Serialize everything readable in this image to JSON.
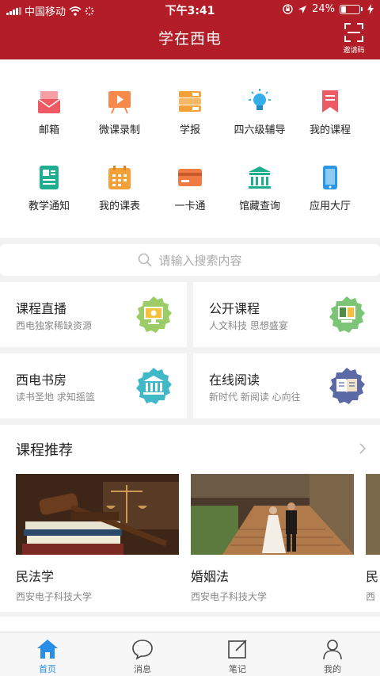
{
  "status_bar": {
    "carrier": "中国移动",
    "time": "下午3:41",
    "battery": "24%"
  },
  "header": {
    "title": "学在西电",
    "invite_label": "邀请码"
  },
  "grid_items": [
    {
      "label": "邮箱",
      "icon": "mail-icon",
      "color": "#ee5a63"
    },
    {
      "label": "微课录制",
      "icon": "video-record-icon",
      "color": "#f58a4c"
    },
    {
      "label": "学报",
      "icon": "journal-icon",
      "color": "#f5a13a"
    },
    {
      "label": "四六级辅导",
      "icon": "lightbulb-icon",
      "color": "#37aee8"
    },
    {
      "label": "我的课程",
      "icon": "bookmark-icon",
      "color": "#ee5a63"
    },
    {
      "label": "教学通知",
      "icon": "notice-icon",
      "color": "#1fae8f"
    },
    {
      "label": "我的课表",
      "icon": "calendar-icon",
      "color": "#f5a13a"
    },
    {
      "label": "一卡通",
      "icon": "card-icon",
      "color": "#f27a43"
    },
    {
      "label": "馆藏查询",
      "icon": "library-icon",
      "color": "#1fae8f"
    },
    {
      "label": "应用大厅",
      "icon": "phone-icon",
      "color": "#2a96e6"
    }
  ],
  "search": {
    "placeholder": "请输入搜索内容"
  },
  "cards": [
    {
      "title": "课程直播",
      "subtitle": "西电独家稀缺资源",
      "icon": "live-screen-icon",
      "color": "#9ccc65"
    },
    {
      "title": "公开课程",
      "subtitle": "人文科技 思想盛宴",
      "icon": "open-book-icon",
      "color": "#7cc576"
    },
    {
      "title": "西电书房",
      "subtitle": "读书圣地 求知摇篮",
      "icon": "building-icon",
      "color": "#3fb8c8"
    },
    {
      "title": "在线阅读",
      "subtitle": "新时代 新阅读 心向往",
      "icon": "reading-book-icon",
      "color": "#5b6aa6"
    }
  ],
  "recommend": {
    "title": "课程推荐",
    "courses": [
      {
        "name": "民法学",
        "school": "西安电子科技大学"
      },
      {
        "name": "婚姻法",
        "school": "西安电子科技大学"
      },
      {
        "name": "民",
        "school": "西"
      }
    ]
  },
  "tabbar": [
    {
      "label": "首页",
      "icon": "home-icon",
      "active": true
    },
    {
      "label": "消息",
      "icon": "message-icon",
      "active": false
    },
    {
      "label": "笔记",
      "icon": "note-icon",
      "active": false
    },
    {
      "label": "我的",
      "icon": "profile-icon",
      "active": false
    }
  ],
  "colors": {
    "brand": "#b31d27",
    "active_tab": "#2a8de6"
  }
}
